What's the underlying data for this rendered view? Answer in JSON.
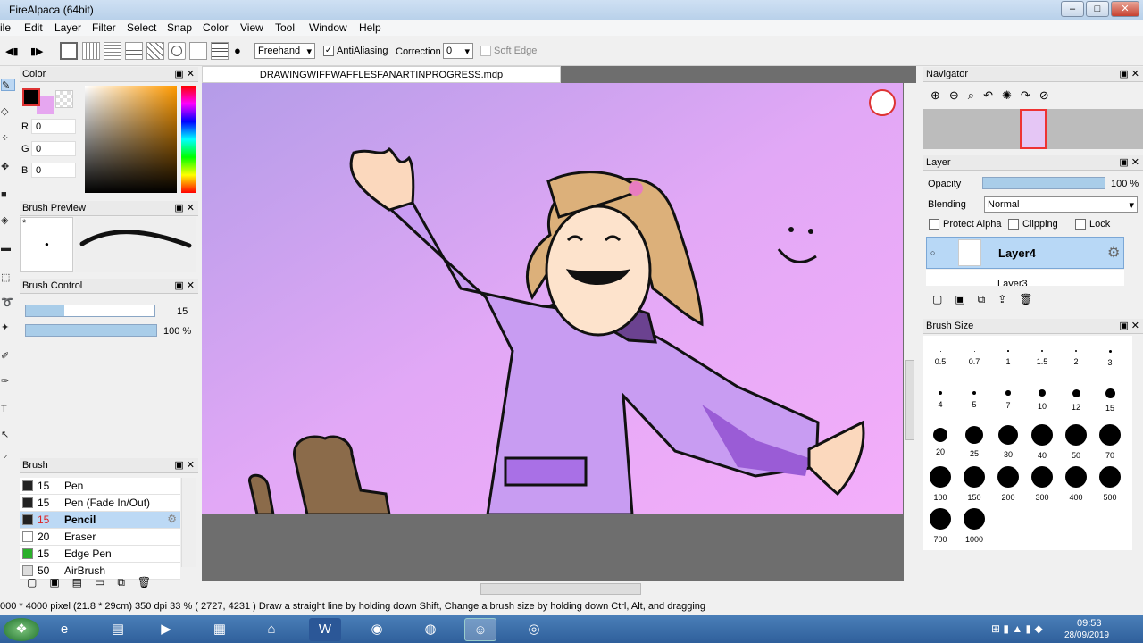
{
  "window": {
    "title": "FireAlpaca (64bit)",
    "min": "–",
    "max": "□",
    "close": "✕"
  },
  "menu": [
    "ile",
    "Edit",
    "Layer",
    "Filter",
    "Select",
    "Snap",
    "Color",
    "View",
    "Tool",
    "Window",
    "Help"
  ],
  "toolbar": {
    "stroke_mode": "Freehand",
    "antialiasing_label": "AntiAliasing",
    "antialiasing_checked": "✓",
    "correction_label": "Correction",
    "correction_value": "0",
    "soft_edge_label": "Soft Edge"
  },
  "color_panel": {
    "title": "Color",
    "r_label": "R",
    "r_value": "0",
    "g_label": "G",
    "g_value": "0",
    "b_label": "B",
    "b_value": "0",
    "fg_color": "#000000",
    "bg_color": "#e6a6f0"
  },
  "brush_preview": {
    "title": "Brush Preview",
    "star": "*"
  },
  "brush_control": {
    "title": "Brush Control",
    "size_value": "15",
    "opacity_value": "100 %",
    "size_fraction": 0.3,
    "opacity_fraction": 1.0
  },
  "brush_panel": {
    "title": "Brush",
    "items": [
      {
        "size": "15",
        "name": "Pen",
        "color": "#222222"
      },
      {
        "size": "15",
        "name": "Pen (Fade In/Out)",
        "color": "#222222"
      },
      {
        "size": "15",
        "name": "Pencil",
        "color": "#222222"
      },
      {
        "size": "20",
        "name": "Eraser",
        "color": "#ffffff"
      },
      {
        "size": "15",
        "name": "Edge Pen",
        "color": "#2bb02b"
      },
      {
        "size": "50",
        "name": "AirBrush",
        "color": "#dddddd"
      }
    ],
    "selected_index": 2
  },
  "document": {
    "tab": "DRAWINGWIFFWAFFLESFANARTINPROGRESS.mdp"
  },
  "navigator": {
    "title": "Navigator"
  },
  "layer_panel": {
    "title": "Layer",
    "opacity_label": "Opacity",
    "opacity_value": "100 %",
    "blending_label": "Blending",
    "blending_value": "Normal",
    "protect_alpha": "Protect Alpha",
    "clipping": "Clipping",
    "lock": "Lock",
    "layers": [
      "Layer4",
      "Layer3"
    ]
  },
  "brush_size": {
    "title": "Brush Size",
    "sizes": [
      "0.5",
      "0.7",
      "1",
      "1.5",
      "2",
      "3",
      "4",
      "5",
      "7",
      "10",
      "12",
      "15",
      "20",
      "25",
      "30",
      "40",
      "50",
      "70",
      "100",
      "150",
      "200",
      "300",
      "400",
      "500",
      "700",
      "1000"
    ]
  },
  "status": {
    "text": "000 * 4000 pixel   (21.8 * 29cm)   350 dpi   33 %    ( 2727, 4231 )   Draw a straight line by holding down Shift, Change a brush size by holding down Ctrl, Alt, and dragging"
  },
  "taskbar": {
    "time": "09:53",
    "date": "28/09/2019"
  },
  "colors": {
    "canvas_bg_top": "#b9a4ee",
    "canvas_bg_bottom": "#f0a6f8",
    "hoodie": "#c79af0",
    "hair": "#d9b07a"
  }
}
